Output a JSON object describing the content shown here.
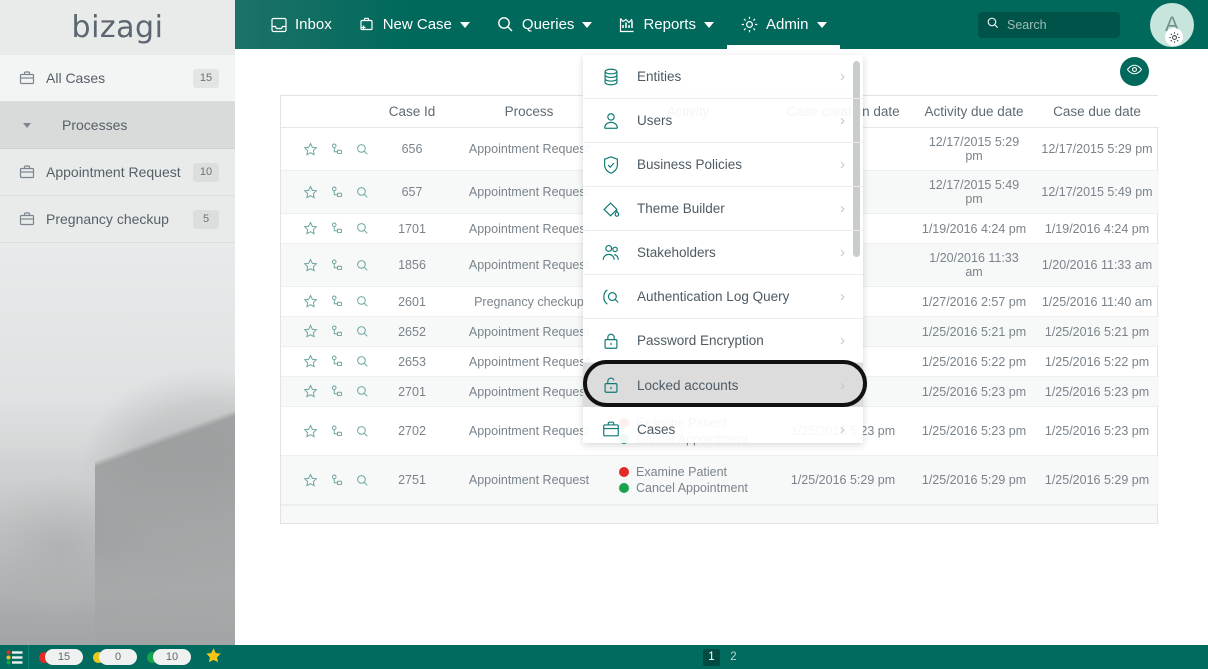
{
  "brand": {
    "name": "bizagi"
  },
  "sidebar": {
    "items": [
      {
        "label": "All Cases",
        "badge": "15",
        "icon": "briefcase-icon",
        "type": "case"
      },
      {
        "label": "Processes",
        "badge": "",
        "icon": "chevron-down-icon",
        "type": "group"
      },
      {
        "label": "Appointment Request",
        "badge": "10",
        "icon": "briefcase-icon",
        "type": "case"
      },
      {
        "label": "Pregnancy checkup",
        "badge": "5",
        "icon": "briefcase-icon",
        "type": "case"
      }
    ]
  },
  "header": {
    "tabs": [
      {
        "label": "Inbox",
        "icon": "inbox-icon",
        "caret": false,
        "active": false
      },
      {
        "label": "New Case",
        "icon": "new-case-icon",
        "caret": true,
        "active": false
      },
      {
        "label": "Queries",
        "icon": "search-icon",
        "caret": true,
        "active": false
      },
      {
        "label": "Reports",
        "icon": "chart-icon",
        "caret": true,
        "active": false
      },
      {
        "label": "Admin",
        "icon": "gear-icon",
        "caret": true,
        "active": true
      }
    ],
    "search": {
      "placeholder": "Search",
      "value": ""
    },
    "avatar": {
      "initial": "A"
    }
  },
  "admin_menu": {
    "items": [
      {
        "label": "Entities",
        "icon": "database-icon",
        "highlight": false
      },
      {
        "label": "Users",
        "icon": "user-icon",
        "highlight": false
      },
      {
        "label": "Business Policies",
        "icon": "shield-check-icon",
        "highlight": false
      },
      {
        "label": "Theme Builder",
        "icon": "paint-bucket-icon",
        "highlight": false
      },
      {
        "label": "Stakeholders",
        "icon": "stakeholders-icon",
        "highlight": false
      },
      {
        "label": "Authentication Log Query",
        "icon": "log-search-icon",
        "highlight": false
      },
      {
        "label": "Password Encryption",
        "icon": "lock-closed-icon",
        "highlight": false
      },
      {
        "label": "Locked accounts",
        "icon": "lock-open-icon",
        "highlight": true
      },
      {
        "label": "Cases",
        "icon": "briefcase-icon",
        "highlight": false
      }
    ]
  },
  "table": {
    "columns": [
      "",
      "Case Id",
      "Process",
      "Activity",
      "Case creation date",
      "Activity due date",
      "Case due date"
    ],
    "rows": [
      {
        "case_id": "656",
        "process": "Appointment Request",
        "activities": [],
        "creation": "",
        "activity_due": "12/17/2015 5:29 pm",
        "case_due": "12/17/2015 5:29 pm"
      },
      {
        "case_id": "657",
        "process": "Appointment Request",
        "activities": [],
        "creation": "",
        "activity_due": "12/17/2015 5:49 pm",
        "case_due": "12/17/2015 5:49 pm"
      },
      {
        "case_id": "1701",
        "process": "Appointment Request",
        "activities": [],
        "creation": "",
        "activity_due": "1/19/2016 4:24 pm",
        "case_due": "1/19/2016 4:24 pm"
      },
      {
        "case_id": "1856",
        "process": "Appointment Request",
        "activities": [],
        "creation": "",
        "activity_due": "1/20/2016 11:33 am",
        "case_due": "1/20/2016 11:33 am"
      },
      {
        "case_id": "2601",
        "process": "Pregnancy checkup",
        "activities": [],
        "creation": "",
        "activity_due": "1/27/2016 2:57 pm",
        "case_due": "1/25/2016 11:40 am"
      },
      {
        "case_id": "2652",
        "process": "Appointment Request",
        "activities": [],
        "creation": "",
        "activity_due": "1/25/2016 5:21 pm",
        "case_due": "1/25/2016 5:21 pm"
      },
      {
        "case_id": "2653",
        "process": "Appointment Request",
        "activities": [],
        "creation": "",
        "activity_due": "1/25/2016 5:22 pm",
        "case_due": "1/25/2016 5:22 pm"
      },
      {
        "case_id": "2701",
        "process": "Appointment Request",
        "activities": [],
        "creation": "",
        "activity_due": "1/25/2016 5:23 pm",
        "case_due": "1/25/2016 5:23 pm"
      },
      {
        "case_id": "2702",
        "process": "Appointment Request",
        "activities": [
          {
            "label": "Examine Patient",
            "status": "red"
          },
          {
            "label": "Cancel Appointment",
            "status": "green"
          }
        ],
        "creation": "1/25/2016 5:23 pm",
        "activity_due": "1/25/2016 5:23 pm",
        "case_due": "1/25/2016 5:23 pm"
      },
      {
        "case_id": "2751",
        "process": "Appointment Request",
        "activities": [
          {
            "label": "Examine Patient",
            "status": "red"
          },
          {
            "label": "Cancel Appointment",
            "status": "green"
          }
        ],
        "creation": "1/25/2016 5:29 pm",
        "activity_due": "1/25/2016 5:29 pm",
        "case_due": "1/25/2016 5:29 pm"
      }
    ],
    "row_action_icons": [
      "star-icon",
      "process-tree-icon",
      "magnifier-icon"
    ]
  },
  "statusbar": {
    "chips": [
      {
        "status": "red",
        "value": "15"
      },
      {
        "status": "yellow",
        "value": "0"
      },
      {
        "status": "green",
        "value": "10"
      }
    ],
    "star_icon": "star-icon",
    "menu_icon": "list-menu-icon",
    "pages": [
      {
        "label": "1",
        "active": true
      },
      {
        "label": "2",
        "active": false
      }
    ]
  },
  "colors": {
    "header_green": "#00695c",
    "statusbar_green": "#006b5e",
    "accent_teal": "#0f7a73",
    "status_red": "#e02b27",
    "status_green": "#16a34a",
    "status_yellow": "#e8c81e",
    "sidebar_gray": "#e9eaea"
  }
}
